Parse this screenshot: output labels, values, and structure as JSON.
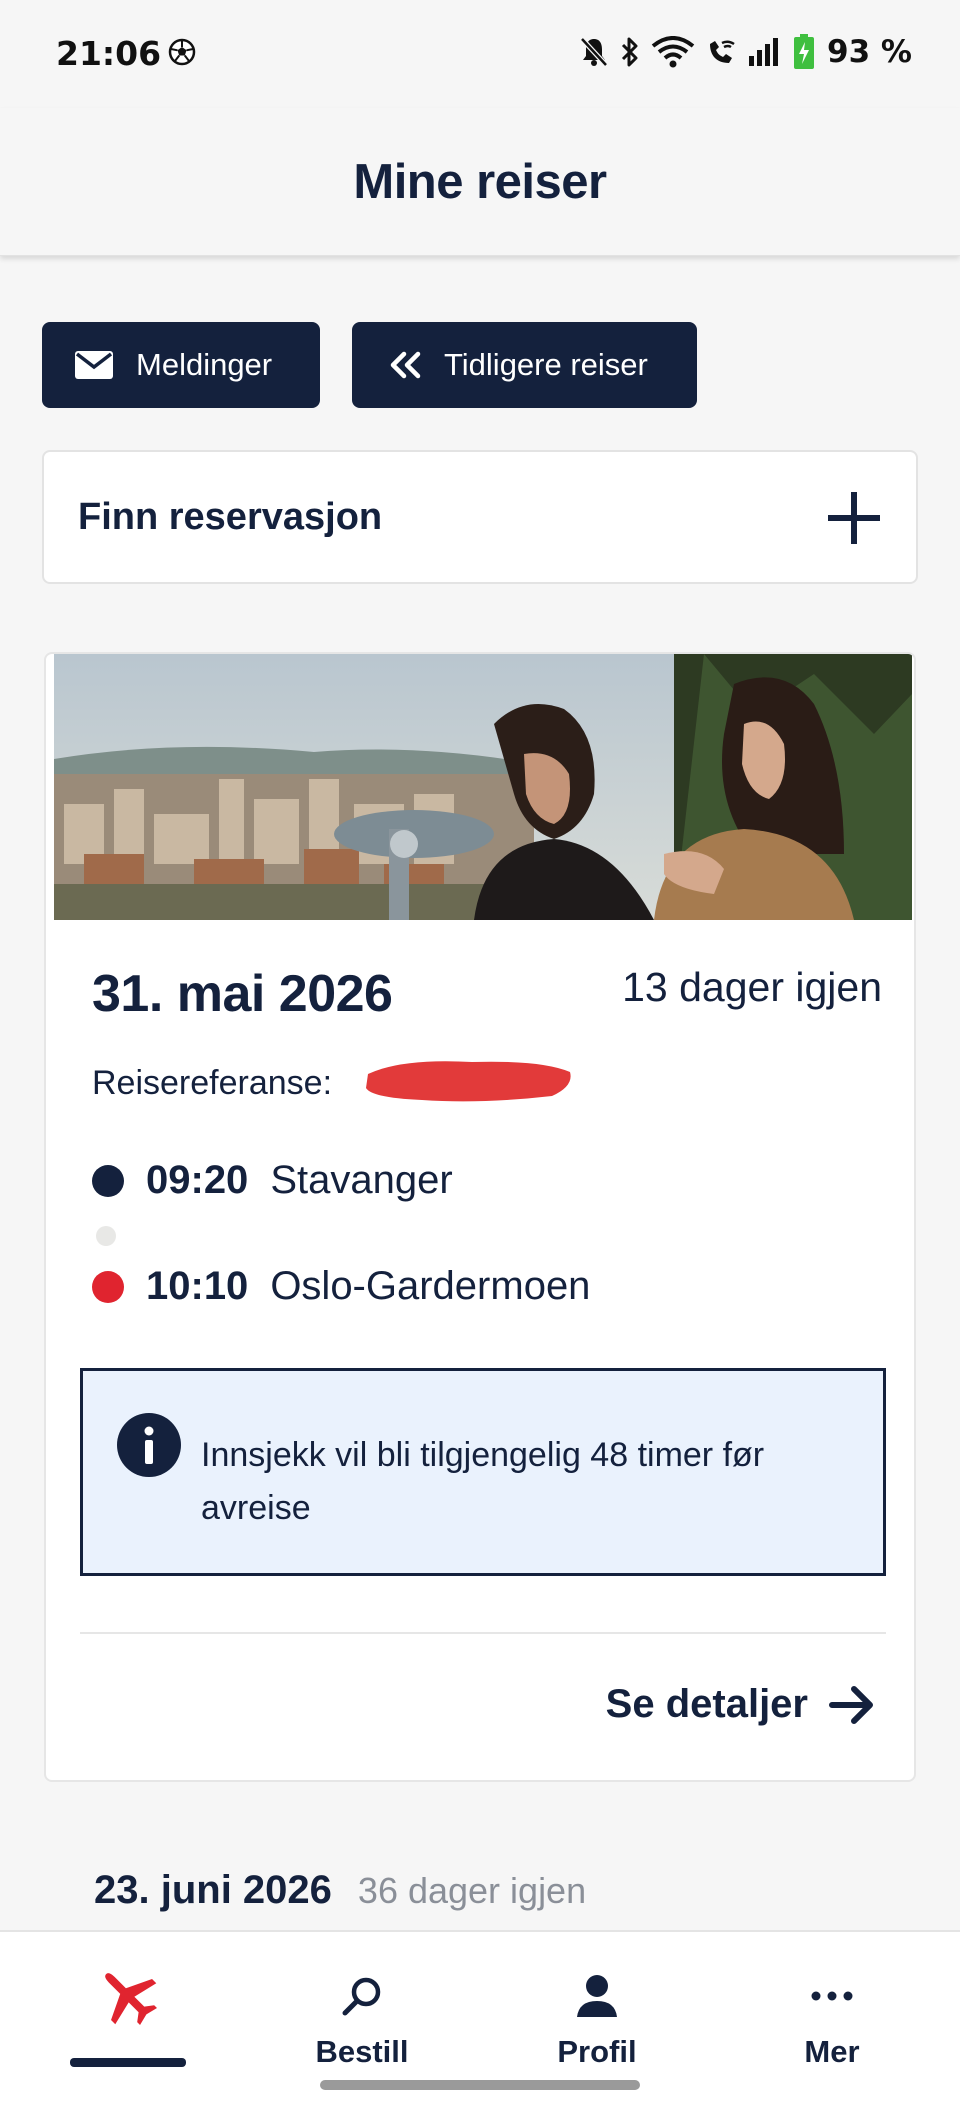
{
  "status_bar": {
    "time": "21:06",
    "battery_percent": "93 %",
    "icons": [
      "football-icon",
      "bell-muted-icon",
      "bluetooth-icon",
      "wifi-icon",
      "wifi-call-icon",
      "signal-icon",
      "battery-charging-icon"
    ]
  },
  "header": {
    "title": "Mine reiser"
  },
  "actions": {
    "messages_label": "Meldinger",
    "previous_trips_label": "Tidligere reiser"
  },
  "find_reservation": {
    "label": "Finn reservasjon"
  },
  "trip": {
    "date": "31. mai 2026",
    "days_left": "13 dager igjen",
    "reference_label": "Reisereferanse:",
    "departure": {
      "time": "09:20",
      "place": "Stavanger"
    },
    "arrival": {
      "time": "10:10",
      "place": "Oslo-Gardermoen"
    },
    "info_text": "Innsjekk vil bli tilgjengelig 48 timer før avreise",
    "details_label": "Se detaljer"
  },
  "next_trip": {
    "date": "23. juni 2026",
    "days_left": "36 dager igjen"
  },
  "bottom_nav": {
    "items": [
      {
        "label": "",
        "icon": "airplane-icon",
        "active": true
      },
      {
        "label": "Bestill",
        "icon": "search-icon"
      },
      {
        "label": "Profil",
        "icon": "person-icon"
      },
      {
        "label": "Mer",
        "icon": "more-dots-icon"
      }
    ]
  },
  "colors": {
    "navy": "#14213d",
    "brand_red": "#e0242f",
    "info_bg": "#eaf2fd",
    "background": "#f6f6f6"
  }
}
